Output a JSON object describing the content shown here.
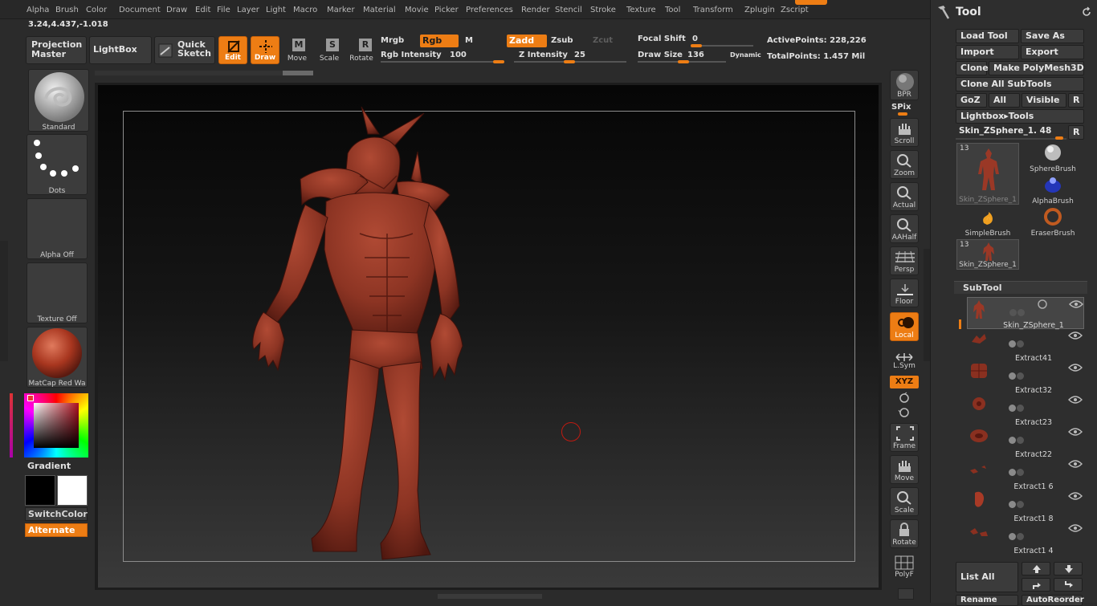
{
  "menu": [
    "Alpha",
    "Brush",
    "Color",
    "Document",
    "Draw",
    "Edit",
    "File",
    "Layer",
    "Light",
    "Macro",
    "Marker",
    "Material",
    "Movie",
    "Picker",
    "Preferences",
    "Render",
    "Stencil",
    "Stroke",
    "Texture",
    "Tool",
    "Transform",
    "Zplugin",
    "Zscript"
  ],
  "coords": "3.24,4.437,-1.018",
  "toolbar": {
    "projection_master": [
      "Projection",
      "Master"
    ],
    "lightbox": "LightBox",
    "quick_sketch": [
      "Quick",
      "Sketch"
    ],
    "edit": "Edit",
    "draw": "Draw",
    "move": "Move",
    "scale": "Scale",
    "rotate": "Rotate",
    "mrgb": "Mrgb",
    "rgb": "Rgb",
    "m": "M",
    "zadd": "Zadd",
    "zsub": "Zsub",
    "zcut": "Zcut",
    "rgb_intensity_label": "Rgb Intensity",
    "rgb_intensity": "100",
    "z_intensity_label": "Z Intensity",
    "z_intensity": "25",
    "focal_shift_label": "Focal Shift",
    "focal_shift": "0",
    "draw_size_label": "Draw Size",
    "draw_size": "136",
    "dynamic": "Dynamic",
    "active_points_label": "ActivePoints:",
    "active_points": "228,226",
    "total_points_label": "TotalPoints:",
    "total_points": "1.457 Mil"
  },
  "left": {
    "brush": "Standard",
    "stroke": "Dots",
    "alpha": "Alpha  Off",
    "texture": "Texture  Off",
    "material": "MatCap  Red  Wa",
    "gradient": "Gradient",
    "switch_color": "SwitchColor",
    "alternate": "Alternate"
  },
  "shelf": [
    "BPR",
    "SPix",
    "Scroll",
    "Zoom",
    "Actual",
    "AAHalf",
    "Persp",
    "Floor",
    "Local",
    "L.Sym",
    "XYZ",
    "Frame",
    "Move",
    "Scale",
    "Rotate",
    "PolyF"
  ],
  "tool": {
    "title": "Tool",
    "buttons": [
      "Load Tool",
      "Save As",
      "Import",
      "Export",
      "Clone",
      "Make PolyMesh3D",
      "Clone All SubTools",
      "GoZ",
      "All",
      "Visible",
      "R",
      "Lightbox▸Tools"
    ],
    "current_tool": "Skin_ZSphere_1. 48",
    "current_tool_r": "R",
    "thumb_count": "13",
    "thumbs": [
      "Skin_ZSphere_1",
      "SphereBrush",
      "AlphaBrush",
      "SimpleBrush",
      "EraserBrush",
      "Skin_ZSphere_1"
    ],
    "subtool_title": "SubTool",
    "subtools": [
      "Skin_ZSphere_1",
      "Extract41",
      "Extract32",
      "Extract23",
      "Extract22",
      "Extract1 6",
      "Extract1 8",
      "Extract1 4"
    ],
    "list_all": "List All",
    "rename": "Rename",
    "auto_reorder": "AutoReorder"
  },
  "colors": {
    "accent": "#ed7d14",
    "bg": "#2b2b2b",
    "panel": "#3a3a3a",
    "model": "#8e3424"
  }
}
